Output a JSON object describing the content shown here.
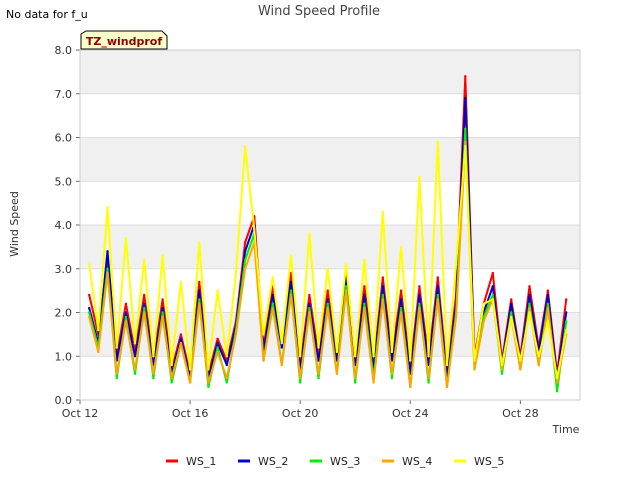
{
  "header": {
    "title": "Wind Speed Profile",
    "no_data_note": "No data for f_u"
  },
  "chart_data": {
    "type": "line",
    "title": "Wind Speed Profile",
    "xlabel": "Time",
    "ylabel": "Wind Speed",
    "site_tag": "TZ_windprof",
    "xlim": [
      "2024-10-12",
      "2024-10-30T04:00"
    ],
    "ylim": [
      0,
      8
    ],
    "y_ticks": [
      "0.0",
      "1.0",
      "2.0",
      "3.0",
      "4.0",
      "5.0",
      "6.0",
      "7.0",
      "8.0"
    ],
    "x_ticks": [
      {
        "date": "2024-10-12",
        "label": "Oct 12"
      },
      {
        "date": "2024-10-16",
        "label": "Oct 16"
      },
      {
        "date": "2024-10-20",
        "label": "Oct 20"
      },
      {
        "date": "2024-10-24",
        "label": "Oct 24"
      },
      {
        "date": "2024-10-28",
        "label": "Oct 28"
      }
    ],
    "grid": true,
    "legend_position": "bottom",
    "x": [
      "2024-10-12T08:00",
      "2024-10-12T16:00",
      "2024-10-13T00:00",
      "2024-10-13T08:00",
      "2024-10-13T16:00",
      "2024-10-14T00:00",
      "2024-10-14T08:00",
      "2024-10-14T16:00",
      "2024-10-15T00:00",
      "2024-10-15T08:00",
      "2024-10-15T16:00",
      "2024-10-16T00:00",
      "2024-10-16T08:00",
      "2024-10-16T16:00",
      "2024-10-17T00:00",
      "2024-10-17T08:00",
      "2024-10-17T16:00",
      "2024-10-18T00:00",
      "2024-10-18T08:00",
      "2024-10-18T16:00",
      "2024-10-19T00:00",
      "2024-10-19T08:00",
      "2024-10-19T16:00",
      "2024-10-20T00:00",
      "2024-10-20T08:00",
      "2024-10-20T16:00",
      "2024-10-21T00:00",
      "2024-10-21T08:00",
      "2024-10-21T16:00",
      "2024-10-22T00:00",
      "2024-10-22T08:00",
      "2024-10-22T16:00",
      "2024-10-23T00:00",
      "2024-10-23T08:00",
      "2024-10-23T16:00",
      "2024-10-24T00:00",
      "2024-10-24T08:00",
      "2024-10-24T16:00",
      "2024-10-25T00:00",
      "2024-10-25T08:00",
      "2024-10-25T16:00",
      "2024-10-26T00:00",
      "2024-10-26T08:00",
      "2024-10-26T16:00",
      "2024-10-27T00:00",
      "2024-10-27T08:00",
      "2024-10-27T16:00",
      "2024-10-28T00:00",
      "2024-10-28T08:00",
      "2024-10-28T16:00",
      "2024-10-29T00:00",
      "2024-10-29T08:00",
      "2024-10-29T16:00"
    ],
    "series": [
      {
        "name": "WS_1",
        "color": "#ff0000",
        "values": [
          2.4,
          1.5,
          3.2,
          1.0,
          2.2,
          1.1,
          2.4,
          0.9,
          2.3,
          0.7,
          1.5,
          0.6,
          2.7,
          0.6,
          1.4,
          0.9,
          1.8,
          3.6,
          4.2,
          1.2,
          2.6,
          1.3,
          2.9,
          0.8,
          2.4,
          1.0,
          2.5,
          1.0,
          3.0,
          0.9,
          2.6,
          0.8,
          2.8,
          1.0,
          2.5,
          0.7,
          2.6,
          0.9,
          2.8,
          0.6,
          2.4,
          7.4,
          1.0,
          2.2,
          2.9,
          0.9,
          2.3,
          1.0,
          2.6,
          1.2,
          2.5,
          0.6,
          2.3
        ]
      },
      {
        "name": "WS_2",
        "color": "#0000cc",
        "values": [
          2.1,
          1.3,
          3.4,
          0.9,
          2.0,
          1.0,
          2.2,
          0.8,
          2.1,
          0.6,
          1.4,
          0.5,
          2.5,
          0.5,
          1.3,
          0.8,
          1.7,
          3.4,
          4.0,
          1.1,
          2.4,
          1.2,
          2.7,
          0.7,
          2.2,
          0.9,
          2.3,
          0.9,
          2.8,
          0.8,
          2.4,
          0.7,
          2.6,
          0.9,
          2.3,
          0.6,
          2.4,
          0.8,
          2.6,
          0.5,
          2.2,
          6.9,
          0.9,
          2.0,
          2.6,
          0.8,
          2.2,
          0.9,
          2.4,
          1.1,
          2.4,
          0.5,
          2.0
        ]
      },
      {
        "name": "WS_3",
        "color": "#00ee00",
        "values": [
          2.0,
          1.2,
          3.0,
          0.5,
          1.9,
          0.6,
          2.1,
          0.5,
          2.0,
          0.4,
          1.3,
          0.4,
          2.3,
          0.3,
          1.2,
          0.4,
          1.6,
          3.2,
          3.8,
          0.9,
          2.2,
          0.8,
          2.5,
          0.4,
          2.1,
          0.5,
          2.2,
          0.6,
          2.6,
          0.4,
          2.2,
          0.5,
          2.4,
          0.5,
          2.1,
          0.3,
          2.2,
          0.4,
          2.4,
          0.3,
          2.0,
          6.2,
          0.7,
          1.9,
          2.4,
          0.6,
          2.0,
          0.7,
          2.2,
          0.8,
          2.2,
          0.2,
          1.8
        ]
      },
      {
        "name": "WS_4",
        "color": "#ffa500",
        "values": [
          1.9,
          1.1,
          2.9,
          0.6,
          1.8,
          0.7,
          2.0,
          0.6,
          1.9,
          0.5,
          1.3,
          0.4,
          2.2,
          0.4,
          1.1,
          0.5,
          1.5,
          3.0,
          3.6,
          0.9,
          2.1,
          0.8,
          2.4,
          0.5,
          2.0,
          0.6,
          2.1,
          0.6,
          2.5,
          0.5,
          2.1,
          0.4,
          2.3,
          0.6,
          2.0,
          0.3,
          2.1,
          0.5,
          2.3,
          0.3,
          1.9,
          5.9,
          0.7,
          1.8,
          2.3,
          0.7,
          1.9,
          0.7,
          2.1,
          0.8,
          2.1,
          0.4,
          1.5
        ]
      },
      {
        "name": "WS_5",
        "color": "#ffff00",
        "values": [
          3.1,
          1.6,
          4.4,
          1.2,
          3.7,
          1.3,
          3.2,
          1.0,
          3.3,
          0.8,
          2.7,
          0.7,
          3.6,
          0.7,
          2.5,
          1.0,
          2.9,
          5.8,
          3.9,
          1.5,
          2.8,
          1.3,
          3.3,
          1.0,
          3.8,
          1.2,
          3.0,
          1.1,
          3.1,
          1.0,
          3.2,
          1.0,
          4.3,
          1.1,
          3.5,
          0.9,
          5.1,
          1.0,
          5.9,
          0.8,
          3.1,
          5.8,
          0.9,
          2.2,
          2.3,
          0.8,
          1.9,
          0.9,
          2.0,
          1.0,
          1.8,
          0.5,
          1.6
        ]
      }
    ]
  }
}
